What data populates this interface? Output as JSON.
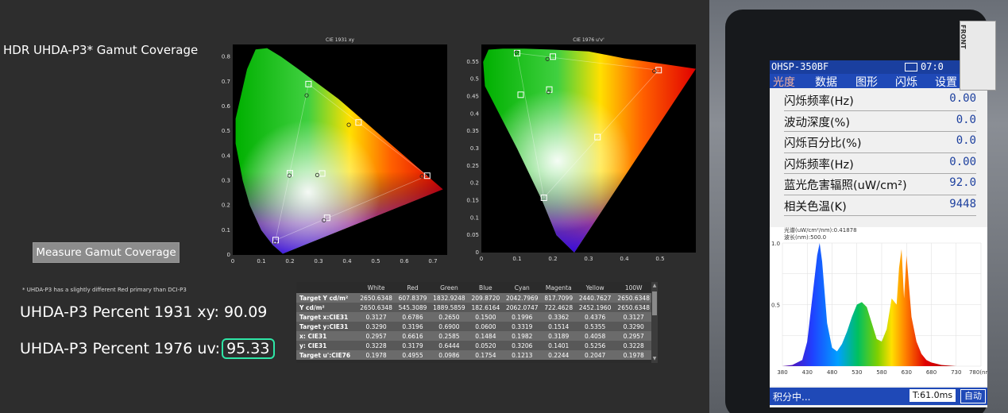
{
  "page": {
    "title": "HDR UHDA-P3* Gamut Coverage",
    "measure_button": "Measure Gamut Coverage",
    "footnote": "* UHDA-P3 has a slightly different Red primary than DCI-P3",
    "result_1931_label": "UHDA-P3 Percent 1931 xy:",
    "result_1931_value": "90.09",
    "result_1976_label": "UHDA-P3 Percent 1976 uv:",
    "result_1976_value": "95.33"
  },
  "colors": {
    "highlight": "#2ee6a6",
    "background": "#2d2d2d",
    "device_blue": "#1f49b7"
  },
  "chart_data": [
    {
      "type": "scatter",
      "title": "CIE 1931 xy",
      "xlim": [
        0,
        0.75
      ],
      "ylim": [
        0,
        0.85
      ],
      "x_ticks": [
        "0",
        "0.1",
        "0.2",
        "0.3",
        "0.4",
        "0.5",
        "0.6",
        "0.7"
      ],
      "y_ticks": [
        "0",
        "0.1",
        "0.2",
        "0.3",
        "0.4",
        "0.5",
        "0.6",
        "0.7",
        "0.8"
      ],
      "series": [
        {
          "marker": "square",
          "points": [
            [
              0.15,
              0.06
            ],
            [
              0.265,
              0.69
            ],
            [
              0.68,
              0.32
            ],
            [
              0.3127,
              0.329
            ],
            [
              0.2,
              0.33
            ],
            [
              0.44,
              0.535
            ],
            [
              0.33,
              0.15
            ]
          ]
        },
        {
          "marker": "circle",
          "points": [
            [
              0.2585,
              0.6444
            ],
            [
              0.6616,
              0.3179
            ],
            [
              0.1484,
              0.052
            ],
            [
              0.2957,
              0.3228
            ],
            [
              0.4058,
              0.5256
            ],
            [
              0.1982,
              0.3206
            ],
            [
              0.3189,
              0.1401
            ]
          ]
        }
      ]
    },
    {
      "type": "scatter",
      "title": "CIE 1976 u'v'",
      "xlim": [
        0,
        0.6
      ],
      "ylim": [
        0,
        0.6
      ],
      "x_ticks": [
        "0",
        "0.1",
        "0.2",
        "0.3",
        "0.4",
        "0.5"
      ],
      "y_ticks": [
        "0",
        "0.05",
        "0.1",
        "0.15",
        "0.2",
        "0.25",
        "0.3",
        "0.35",
        "0.4",
        "0.45",
        "0.5",
        "0.55"
      ],
      "series": [
        {
          "marker": "square",
          "points": [
            [
              0.1,
              0.575
            ],
            [
              0.175,
              0.158
            ],
            [
              0.496,
              0.526
            ],
            [
              0.2,
              0.565
            ],
            [
              0.325,
              0.333
            ],
            [
              0.19,
              0.47
            ],
            [
              0.11,
              0.455
            ]
          ]
        },
        {
          "marker": "circle",
          "points": [
            [
              0.098,
              0.577
            ],
            [
              0.185,
              0.558
            ],
            [
              0.484,
              0.523
            ],
            [
              0.188,
              0.463
            ]
          ]
        }
      ]
    },
    {
      "type": "table",
      "columns": [
        "",
        "White",
        "Red",
        "Green",
        "Blue",
        "Cyan",
        "Magenta",
        "Yellow",
        "100W"
      ],
      "rows": [
        [
          "Target Y cd/m²",
          "2650.6348",
          "607.8379",
          "1832.9248",
          "209.8720",
          "2042.7969",
          "817.7099",
          "2440.7627",
          "2650.6348"
        ],
        [
          "Y cd/m²",
          "2650.6348",
          "545.3089",
          "1889.5859",
          "182.6164",
          "2062.0747",
          "722.4628",
          "2452.1960",
          "2650.6348"
        ],
        [
          "Target x:CIE31",
          "0.3127",
          "0.6786",
          "0.2650",
          "0.1500",
          "0.1996",
          "0.3362",
          "0.4376",
          "0.3127"
        ],
        [
          "Target y:CIE31",
          "0.3290",
          "0.3196",
          "0.6900",
          "0.0600",
          "0.3319",
          "0.1514",
          "0.5355",
          "0.3290"
        ],
        [
          "x: CIE31",
          "0.2957",
          "0.6616",
          "0.2585",
          "0.1484",
          "0.1982",
          "0.3189",
          "0.4058",
          "0.2957"
        ],
        [
          "y: CIE31",
          "0.3228",
          "0.3179",
          "0.6444",
          "0.0520",
          "0.3206",
          "0.1401",
          "0.5256",
          "0.3228"
        ],
        [
          "Target u':CIE76",
          "0.1978",
          "0.4955",
          "0.0986",
          "0.1754",
          "0.1213",
          "0.2244",
          "0.2047",
          "0.1978"
        ]
      ]
    },
    {
      "type": "area",
      "title": "",
      "xlabel": "",
      "ylabel": "",
      "x_ticks": [
        "380",
        "430",
        "480",
        "530",
        "580",
        "630",
        "680",
        "730",
        "780(nm)"
      ],
      "y_ticks": [
        "1.0",
        "0.5"
      ],
      "legend_lines": [
        "光谱(uW/cm²/nm):0.41878",
        "波长(nm):500.0"
      ],
      "x": [
        380,
        400,
        420,
        430,
        440,
        450,
        455,
        460,
        470,
        480,
        490,
        500,
        510,
        520,
        530,
        540,
        550,
        560,
        570,
        580,
        590,
        600,
        610,
        615,
        620,
        625,
        630,
        640,
        650,
        660,
        670,
        680,
        700,
        730,
        780
      ],
      "values": [
        0,
        0.01,
        0.05,
        0.2,
        0.55,
        0.9,
        1.0,
        0.85,
        0.35,
        0.15,
        0.12,
        0.18,
        0.28,
        0.4,
        0.5,
        0.52,
        0.48,
        0.35,
        0.22,
        0.2,
        0.3,
        0.55,
        0.5,
        0.8,
        0.95,
        0.55,
        0.9,
        0.4,
        0.2,
        0.1,
        0.05,
        0.03,
        0.01,
        0,
        0
      ]
    }
  ],
  "device": {
    "sticker_text": "FRONT",
    "model": "OHSP-350BF",
    "time": "07:0",
    "tabs": [
      "光度",
      "数据",
      "图形",
      "闪烁",
      "设置"
    ],
    "rows": [
      {
        "label": "闪烁频率(Hz)",
        "value": "0.00"
      },
      {
        "label": "波动深度(%)",
        "value": "0.0"
      },
      {
        "label": "闪烁百分比(%)",
        "value": "0.0"
      },
      {
        "label": "闪烁频率(Hz)",
        "value": "0.00"
      },
      {
        "label": "蓝光危害辐照(uW/cm²)",
        "value": "92.0"
      },
      {
        "label": "相关色温(K)",
        "value": "9448"
      }
    ],
    "status_left": "积分中...",
    "status_time": "T:61.0ms",
    "status_right": "自动"
  }
}
